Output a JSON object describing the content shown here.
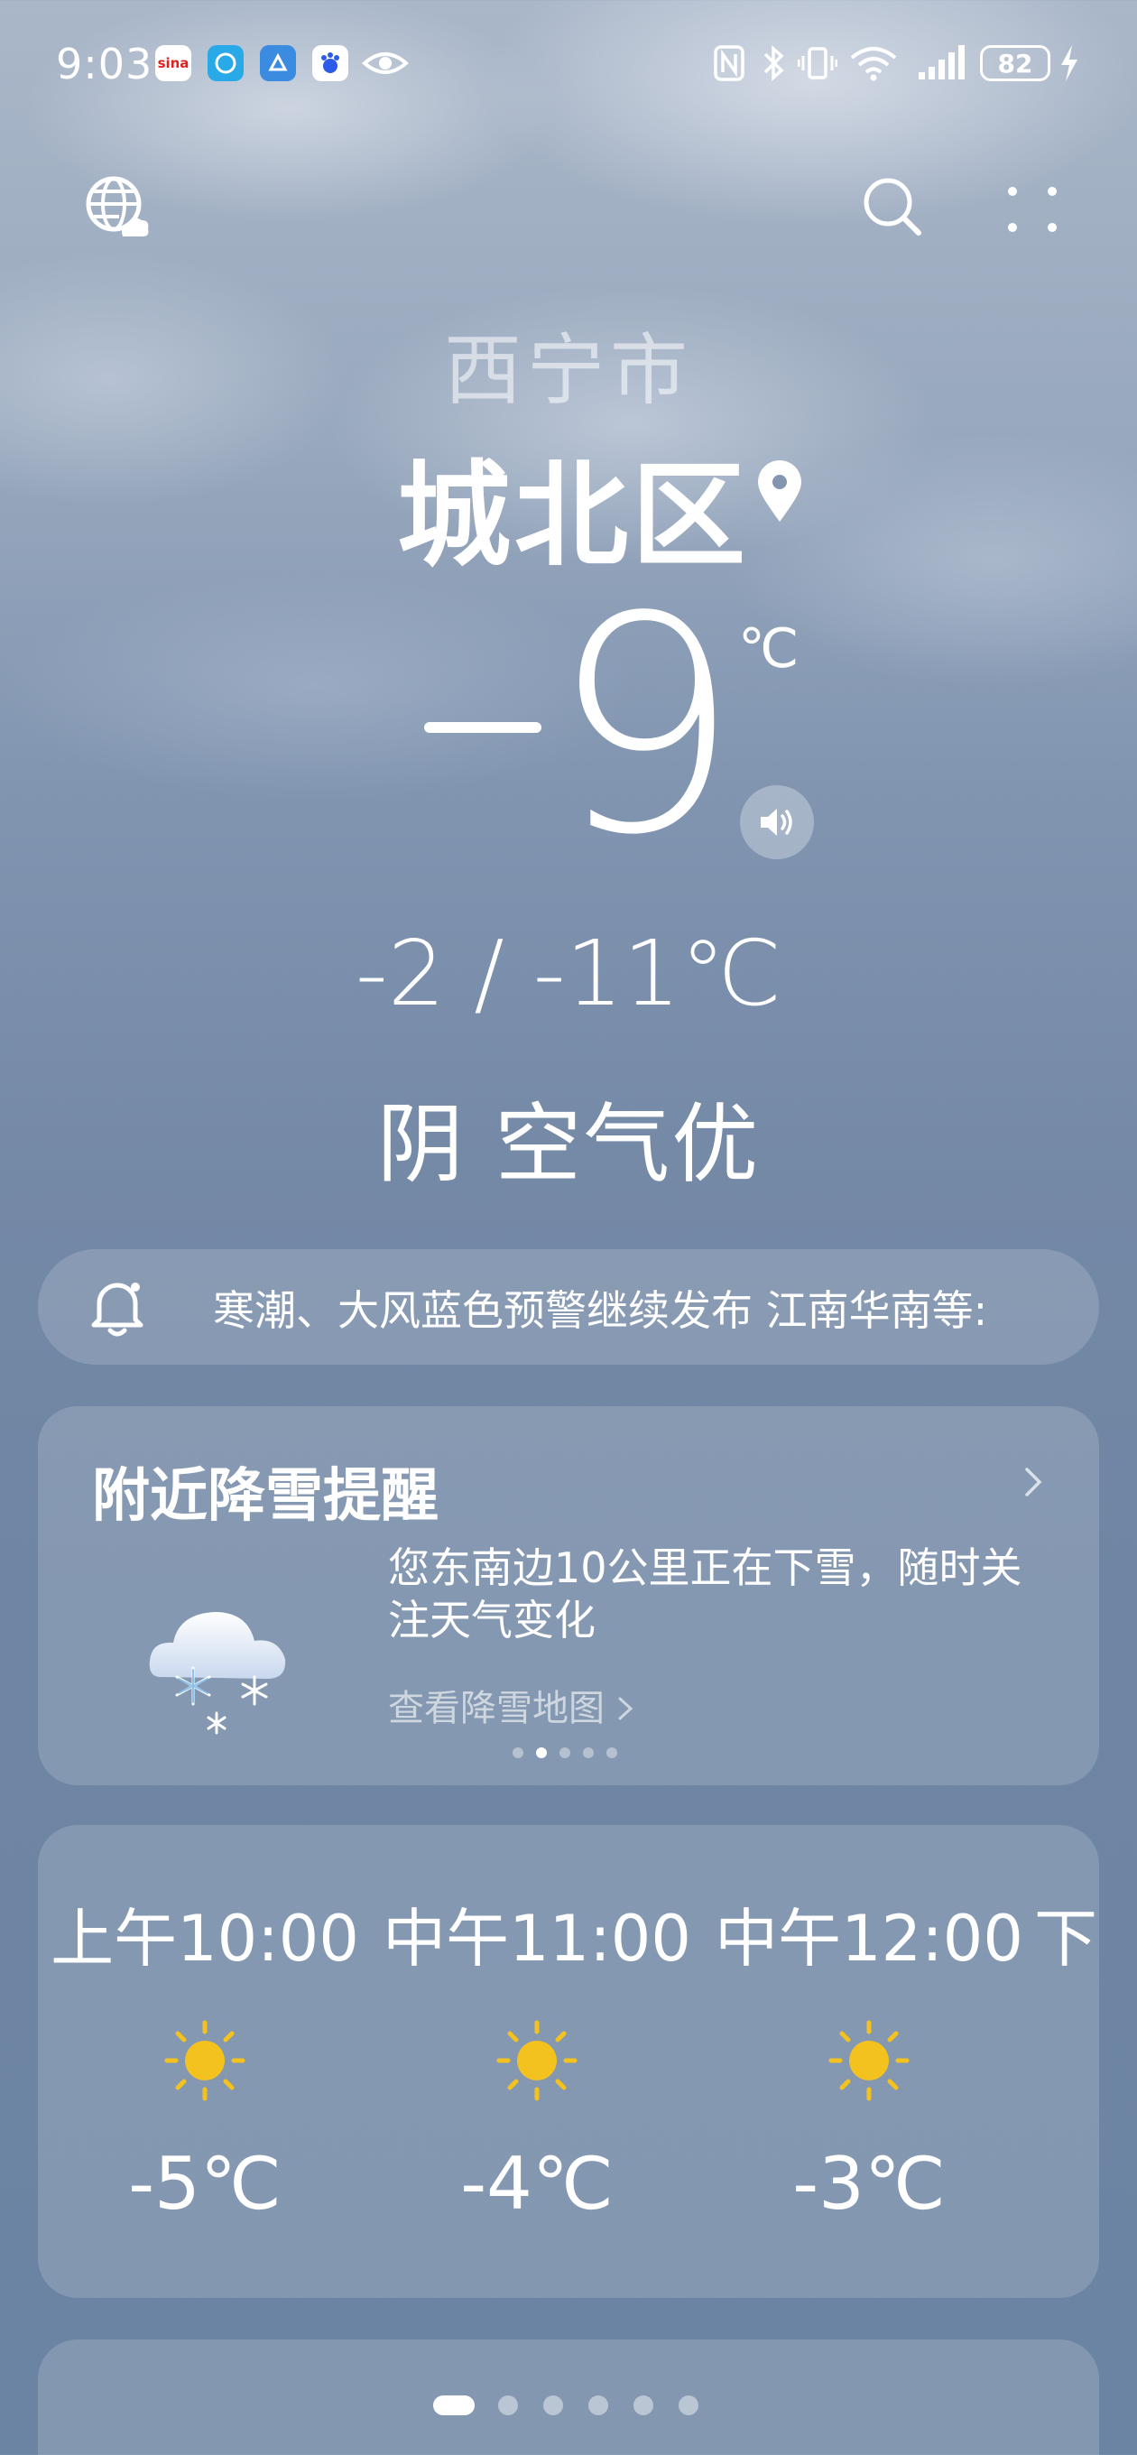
{
  "status_bar": {
    "time": "9:03",
    "apps": [
      "sina-app-icon",
      "app-icon-blue",
      "browser-icon",
      "baidu-icon",
      "eye-icon"
    ],
    "battery": "82",
    "icons": [
      "nfc-icon",
      "bluetooth-icon",
      "vibrate-icon",
      "wifi-icon",
      "signal-icon",
      "charging-icon"
    ]
  },
  "header": {
    "city": "西宁市",
    "district": "城北区",
    "temperature": "9",
    "unit": "℃",
    "range": "-2 / -11℃",
    "condition": "阴 空气优"
  },
  "alert": {
    "text": "寒潮、大风蓝色预警继续发布 江南华南等:"
  },
  "snow_card": {
    "title": "附近降雪提醒",
    "message": "您东南边10公里正在下雪，随时关注天气变化",
    "link": "查看降雪地图",
    "carousel_dots": 5,
    "active_dot": 1
  },
  "hourly": [
    {
      "time": "上午10:00",
      "icon": "sun-icon",
      "temp": "-5℃"
    },
    {
      "time": "中午11:00",
      "icon": "sun-icon",
      "temp": "-4℃"
    },
    {
      "time": "中午12:00",
      "icon": "sun-icon",
      "temp": "-3℃"
    },
    {
      "time": "下",
      "icon": "sun-icon",
      "temp": ""
    }
  ],
  "pager": {
    "count": 6,
    "active": 0
  },
  "colors": {
    "sun": "#f4c21f",
    "accent": "#ffffff"
  }
}
